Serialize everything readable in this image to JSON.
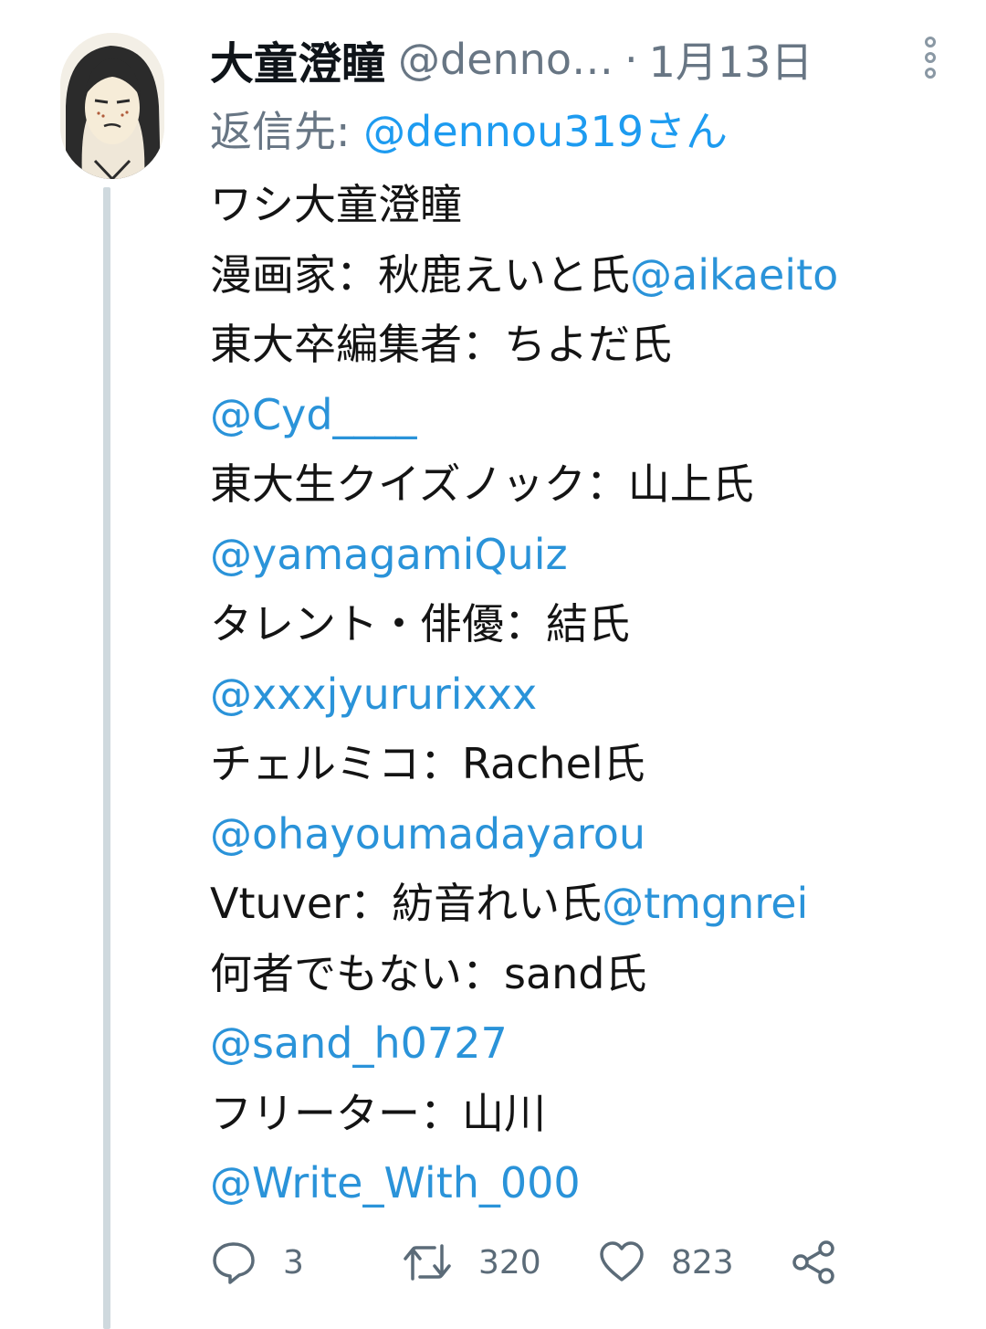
{
  "tweet": {
    "author_name": "大童澄瞳",
    "author_handle": "@denno…",
    "separator": "·",
    "timestamp": "1月13日",
    "reply_label": "返信先: ",
    "reply_to": "@dennou319さん",
    "lines": [
      [
        {
          "text": "ワシ大童澄瞳"
        }
      ],
      [
        {
          "text": "漫画家：秋鹿えいと氏"
        },
        {
          "text": "@aikaeito",
          "mention": true
        }
      ],
      [
        {
          "text": "東大卒編集者：ちよだ氏"
        }
      ],
      [
        {
          "text": "@Cyd____",
          "mention": true
        }
      ],
      [
        {
          "text": "東大生クイズノック：山上氏"
        }
      ],
      [
        {
          "text": "@yamagamiQuiz",
          "mention": true
        }
      ],
      [
        {
          "text": "タレント・俳優：結氏"
        }
      ],
      [
        {
          "text": "@xxxjyururixxx",
          "mention": true
        }
      ],
      [
        {
          "text": "チェルミコ：Rachel氏"
        }
      ],
      [
        {
          "text": "@ohayoumadayarou",
          "mention": true
        }
      ],
      [
        {
          "text": "Vtuver：紡音れい氏"
        },
        {
          "text": "@tmgnrei",
          "mention": true
        }
      ],
      [
        {
          "text": "何者でもない：sand氏"
        }
      ],
      [
        {
          "text": "@sand_h0727",
          "mention": true
        }
      ],
      [
        {
          "text": "フリーター：山川"
        }
      ],
      [
        {
          "text": "@Write_With_000",
          "mention": true
        }
      ]
    ]
  },
  "actions": {
    "reply_count": "3",
    "retweet_count": "320",
    "like_count": "823"
  },
  "icons": {
    "avatar": "avatar-illustration",
    "more": "more-vertical-icon",
    "reply": "reply-bubble-icon",
    "retweet": "retweet-icon",
    "like": "heart-icon",
    "share": "share-icon"
  },
  "colors": {
    "mention": "#2a93d9",
    "muted": "#687684",
    "thread_line": "#cfd9de"
  }
}
